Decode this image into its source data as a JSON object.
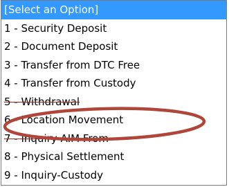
{
  "select": {
    "options": [
      {
        "label": "[Select an Option]",
        "selected": true
      },
      {
        "label": "1 - Security Deposit",
        "selected": false
      },
      {
        "label": "2 - Document Deposit",
        "selected": false
      },
      {
        "label": "3 - Transfer from DTC Free",
        "selected": false
      },
      {
        "label": "4 - Transfer from Custody",
        "selected": false
      },
      {
        "label": "5 - Withdrawal",
        "selected": false
      },
      {
        "label": "6 - Location Movement",
        "selected": false
      },
      {
        "label": "7 - Inquiry-AIM From",
        "selected": false
      },
      {
        "label": "8 - Physical Settlement",
        "selected": false
      },
      {
        "label": "9 - Inquiry-Custody",
        "selected": false
      }
    ]
  },
  "annotation": {
    "highlighted_option": "6 - Location Movement",
    "ring_color": "#b0463a"
  },
  "colors": {
    "selected_bg": "#3399ff",
    "selected_text": "#ffffff",
    "border": "#7a7a7a"
  }
}
